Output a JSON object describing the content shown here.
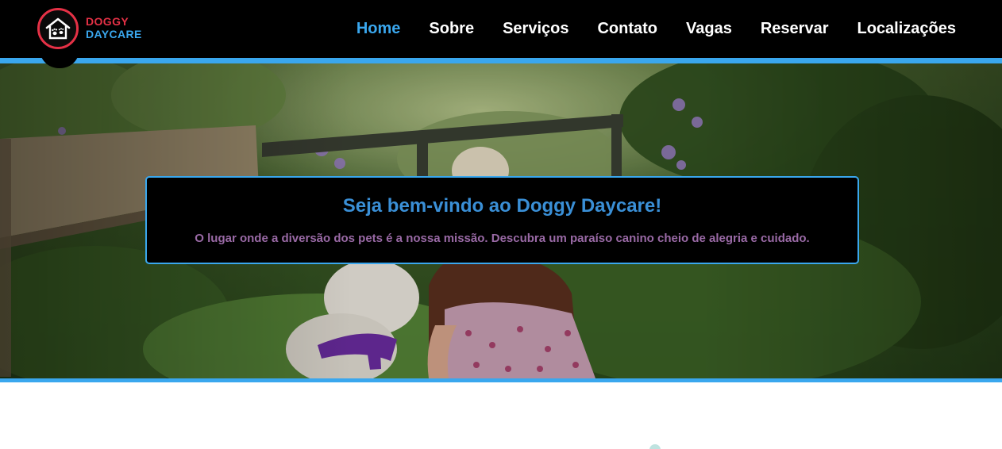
{
  "brand": {
    "line1": "DOGGY",
    "line2": "DAYCARE",
    "logo_icon": "dog-house-paw-icon",
    "colors": {
      "red": "#e53146",
      "blue": "#3aa7ee"
    }
  },
  "nav": {
    "items": [
      {
        "label": "Home",
        "active": true
      },
      {
        "label": "Sobre",
        "active": false
      },
      {
        "label": "Serviços",
        "active": false
      },
      {
        "label": "Contato",
        "active": false
      },
      {
        "label": "Vagas",
        "active": false
      },
      {
        "label": "Reservar",
        "active": false
      },
      {
        "label": "Localizações",
        "active": false
      }
    ]
  },
  "hero": {
    "title": "Seja bem-vindo ao Doggy Daycare!",
    "subtitle": "O lugar onde a diversão dos pets é a nossa missão. Descubra um paraíso canino cheio de alegria e cuidado."
  },
  "sections_peek": {
    "icon": "leaf-icon"
  }
}
